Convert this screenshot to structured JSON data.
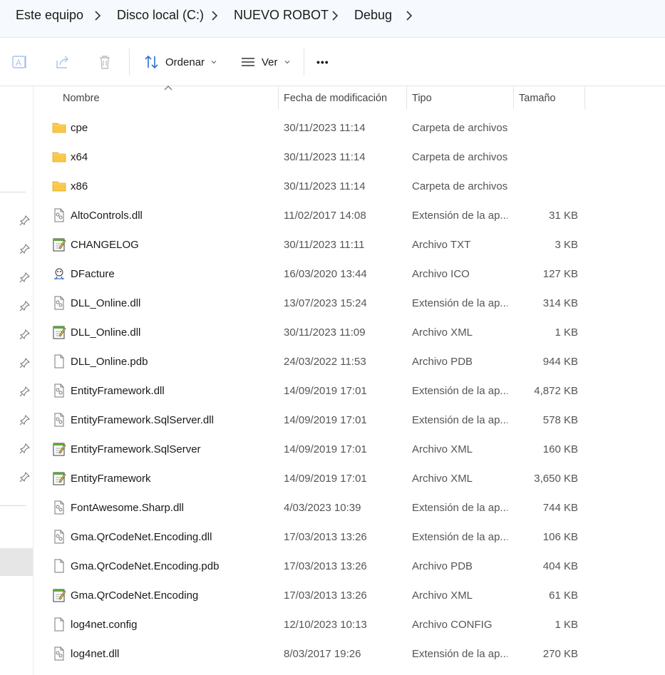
{
  "breadcrumb": {
    "items": [
      "Este equipo",
      "Disco local (C:)",
      "NUEVO ROBOT",
      "Debug"
    ]
  },
  "toolbar": {
    "rename_icon": "rename-icon",
    "share_icon": "share-icon",
    "delete_icon": "trash-icon",
    "sort_label": "Ordenar",
    "view_label": "Ver",
    "more_label": "•••"
  },
  "columns": {
    "name": "Nombre",
    "date": "Fecha de modificación",
    "type": "Tipo",
    "size": "Tamaño"
  },
  "files": [
    {
      "name": "cpe",
      "date": "30/11/2023 11:14",
      "type": "Carpeta de archivos",
      "size": "",
      "icon": "folder"
    },
    {
      "name": "x64",
      "date": "30/11/2023 11:14",
      "type": "Carpeta de archivos",
      "size": "",
      "icon": "folder"
    },
    {
      "name": "x86",
      "date": "30/11/2023 11:14",
      "type": "Carpeta de archivos",
      "size": "",
      "icon": "folder"
    },
    {
      "name": "AltoControls.dll",
      "date": "11/02/2017 14:08",
      "type": "Extensión de la ap...",
      "size": "31 KB",
      "icon": "dll"
    },
    {
      "name": "CHANGELOG",
      "date": "30/11/2023 11:11",
      "type": "Archivo TXT",
      "size": "3 KB",
      "icon": "notepad"
    },
    {
      "name": "DFacture",
      "date": "16/03/2020 13:44",
      "type": "Archivo ICO",
      "size": "127 KB",
      "icon": "ico"
    },
    {
      "name": "DLL_Online.dll",
      "date": "13/07/2023 15:24",
      "type": "Extensión de la ap...",
      "size": "314 KB",
      "icon": "dll"
    },
    {
      "name": "DLL_Online.dll",
      "date": "30/11/2023 11:09",
      "type": "Archivo XML",
      "size": "1 KB",
      "icon": "notepad"
    },
    {
      "name": "DLL_Online.pdb",
      "date": "24/03/2022 11:53",
      "type": "Archivo PDB",
      "size": "944 KB",
      "icon": "file"
    },
    {
      "name": "EntityFramework.dll",
      "date": "14/09/2019 17:01",
      "type": "Extensión de la ap...",
      "size": "4,872 KB",
      "icon": "dll"
    },
    {
      "name": "EntityFramework.SqlServer.dll",
      "date": "14/09/2019 17:01",
      "type": "Extensión de la ap...",
      "size": "578 KB",
      "icon": "dll"
    },
    {
      "name": "EntityFramework.SqlServer",
      "date": "14/09/2019 17:01",
      "type": "Archivo XML",
      "size": "160 KB",
      "icon": "notepad"
    },
    {
      "name": "EntityFramework",
      "date": "14/09/2019 17:01",
      "type": "Archivo XML",
      "size": "3,650 KB",
      "icon": "notepad"
    },
    {
      "name": "FontAwesome.Sharp.dll",
      "date": "4/03/2023 10:39",
      "type": "Extensión de la ap...",
      "size": "744 KB",
      "icon": "dll"
    },
    {
      "name": "Gma.QrCodeNet.Encoding.dll",
      "date": "17/03/2013 13:26",
      "type": "Extensión de la ap...",
      "size": "106 KB",
      "icon": "dll"
    },
    {
      "name": "Gma.QrCodeNet.Encoding.pdb",
      "date": "17/03/2013 13:26",
      "type": "Archivo PDB",
      "size": "404 KB",
      "icon": "file"
    },
    {
      "name": "Gma.QrCodeNet.Encoding",
      "date": "17/03/2013 13:26",
      "type": "Archivo XML",
      "size": "61 KB",
      "icon": "notepad"
    },
    {
      "name": "log4net.config",
      "date": "12/10/2023 10:13",
      "type": "Archivo CONFIG",
      "size": "1 KB",
      "icon": "file"
    },
    {
      "name": "log4net.dll",
      "date": "8/03/2017 19:26",
      "type": "Extensión de la ap...",
      "size": "270 KB",
      "icon": "dll"
    }
  ],
  "nav": {
    "pinned_icon": "pin-icon",
    "pinned_count": 10
  },
  "colors": {
    "folder": "#f8c846",
    "accent": "#2f6fd0",
    "header_bg": "#f6f9fd"
  }
}
